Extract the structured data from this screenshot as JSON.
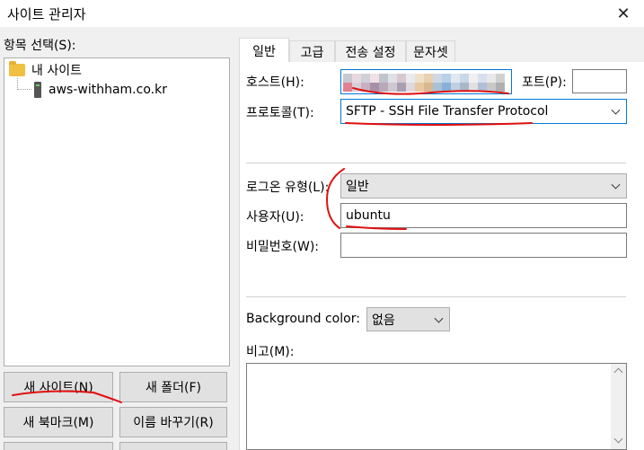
{
  "window": {
    "title": "사이트 관리자",
    "close_label": "✕"
  },
  "left": {
    "section_label": "항목 선택(S):",
    "tree": [
      {
        "label": "내 사이트",
        "icon": "folder-icon"
      },
      {
        "label": "aws-withham.co.kr",
        "icon": "server-icon"
      }
    ],
    "buttons": {
      "new_site": "새 사이트(N)",
      "new_folder": "새 폴더(F)",
      "new_bookmark": "새 북마크(M)",
      "rename": "이름 바꾸기(R)"
    }
  },
  "tabs": [
    {
      "label": "일반",
      "active": true
    },
    {
      "label": "고급"
    },
    {
      "label": "전송 설정"
    },
    {
      "label": "문자셋"
    }
  ],
  "general": {
    "host_label": "호스트(H):",
    "host_value": "",
    "port_label": "포트(P):",
    "port_value": "",
    "protocol_label": "프로토콜(T):",
    "protocol_value": "SFTP - SSH File Transfer Protocol",
    "logon_type_label": "로그온 유형(L):",
    "logon_type_value": "일반",
    "user_label": "사용자(U):",
    "user_value": "ubuntu",
    "password_label": "비밀번호(W):",
    "password_value": "",
    "bg_color_label": "Background color:",
    "bg_color_value": "없음",
    "comments_label": "비고(M):"
  },
  "colors": {
    "annotation_red": "#e01010",
    "focus_blue": "#0078d7"
  }
}
